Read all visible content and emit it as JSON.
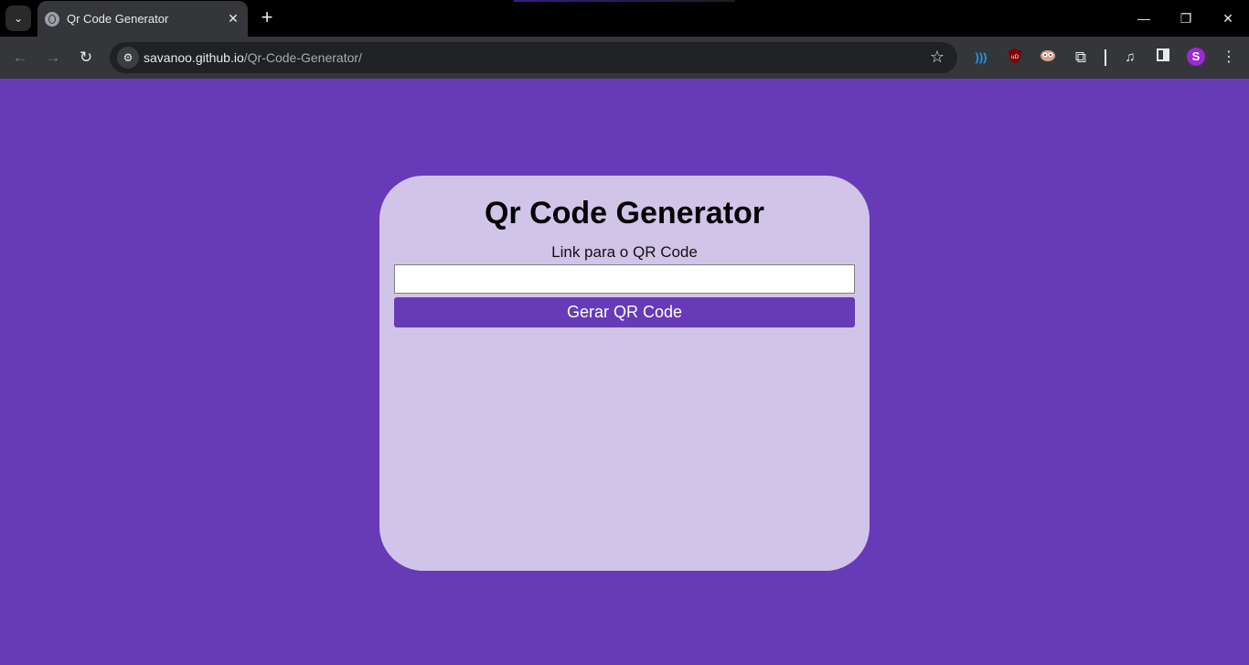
{
  "browser": {
    "tab_title": "Qr Code Generator",
    "url_host": "savanoo.github.io",
    "url_path": "/Qr-Code-Generator/",
    "new_tab_glyph": "+",
    "close_tab_glyph": "✕",
    "window_controls": {
      "minimize": "—",
      "restore": "❐",
      "close": "✕"
    },
    "extensions": [
      "wireless-ext-icon",
      "ublock-icon",
      "owl-ext-icon",
      "extensions-puzzle-icon",
      "media-control-icon",
      "side-panel-icon"
    ],
    "profile_initial": "S"
  },
  "app": {
    "title": "Qr Code Generator",
    "input_label": "Link para o QR Code",
    "input_value": "",
    "input_placeholder": "",
    "button_label": "Gerar QR Code"
  },
  "colors": {
    "page_background": "#673ab7",
    "card_background": "#d1c4e9",
    "button_background": "#673ab7",
    "button_text": "#ffffff"
  }
}
